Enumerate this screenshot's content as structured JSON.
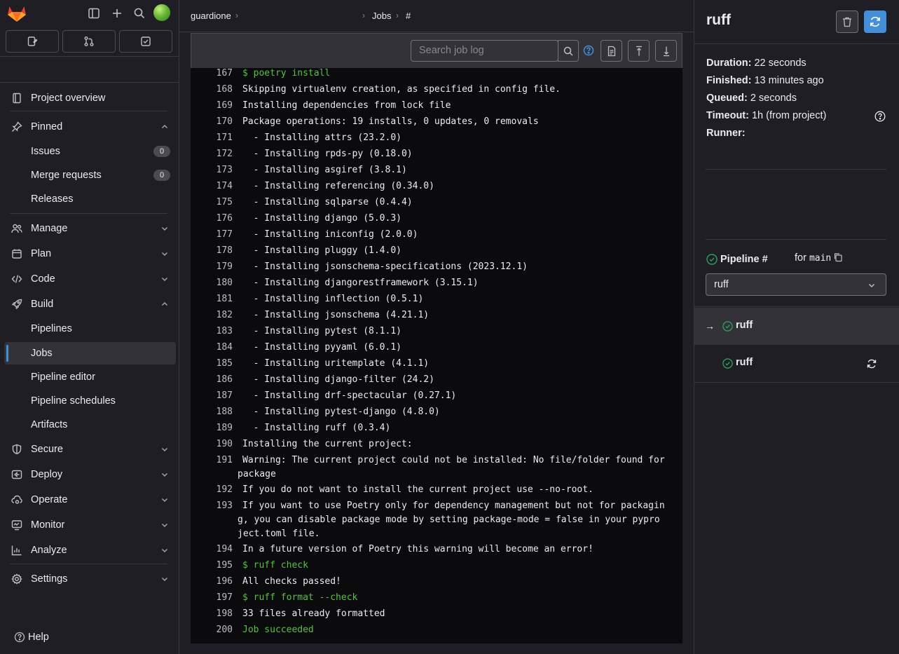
{
  "breadcrumb": {
    "project": "guardione",
    "jobs": "Jobs",
    "job_ref": "#"
  },
  "sidebar": {
    "items": [
      {
        "label": "Project overview"
      },
      {
        "label": "Pinned"
      },
      {
        "label": "Issues",
        "count": "0"
      },
      {
        "label": "Merge requests",
        "count": "0"
      },
      {
        "label": "Releases"
      },
      {
        "label": "Manage"
      },
      {
        "label": "Plan"
      },
      {
        "label": "Code"
      },
      {
        "label": "Build"
      },
      {
        "label": "Pipelines"
      },
      {
        "label": "Jobs"
      },
      {
        "label": "Pipeline editor"
      },
      {
        "label": "Pipeline schedules"
      },
      {
        "label": "Artifacts"
      },
      {
        "label": "Secure"
      },
      {
        "label": "Deploy"
      },
      {
        "label": "Operate"
      },
      {
        "label": "Monitor"
      },
      {
        "label": "Analyze"
      },
      {
        "label": "Settings"
      }
    ],
    "help_label": "Help"
  },
  "log_toolbar": {
    "search_placeholder": "Search job log"
  },
  "log": {
    "lines": [
      {
        "n": "167",
        "text": "$ poetry install"
      },
      {
        "n": "168",
        "text": "Skipping virtualenv creation, as specified in config file."
      },
      {
        "n": "169",
        "text": "Installing dependencies from lock file"
      },
      {
        "n": "170",
        "text": "Package operations: 19 installs, 0 updates, 0 removals"
      },
      {
        "n": "171",
        "text": "  - Installing attrs (23.2.0)"
      },
      {
        "n": "172",
        "text": "  - Installing rpds-py (0.18.0)"
      },
      {
        "n": "173",
        "text": "  - Installing asgiref (3.8.1)"
      },
      {
        "n": "174",
        "text": "  - Installing referencing (0.34.0)"
      },
      {
        "n": "175",
        "text": "  - Installing sqlparse (0.4.4)"
      },
      {
        "n": "176",
        "text": "  - Installing django (5.0.3)"
      },
      {
        "n": "177",
        "text": "  - Installing iniconfig (2.0.0)"
      },
      {
        "n": "178",
        "text": "  - Installing pluggy (1.4.0)"
      },
      {
        "n": "179",
        "text": "  - Installing jsonschema-specifications (2023.12.1)"
      },
      {
        "n": "180",
        "text": "  - Installing djangorestframework (3.15.1)"
      },
      {
        "n": "181",
        "text": "  - Installing inflection (0.5.1)"
      },
      {
        "n": "182",
        "text": "  - Installing jsonschema (4.21.1)"
      },
      {
        "n": "183",
        "text": "  - Installing pytest (8.1.1)"
      },
      {
        "n": "184",
        "text": "  - Installing pyyaml (6.0.1)"
      },
      {
        "n": "185",
        "text": "  - Installing uritemplate (4.1.1)"
      },
      {
        "n": "186",
        "text": "  - Installing django-filter (24.2)"
      },
      {
        "n": "187",
        "text": "  - Installing drf-spectacular (0.27.1)"
      },
      {
        "n": "188",
        "text": "  - Installing pytest-django (4.8.0)"
      },
      {
        "n": "189",
        "text": "  - Installing ruff (0.3.4)"
      },
      {
        "n": "190",
        "text": "Installing the current project:"
      },
      {
        "n": "191",
        "text": "Warning: The current project could not be installed: No file/folder found for package"
      },
      {
        "n": "192",
        "text": "If you do not want to install the current project use --no-root."
      },
      {
        "n": "193",
        "text": "If you want to use Poetry only for dependency management but not for packaging, you can disable package mode by setting package-mode = false in your pyproject.toml file."
      },
      {
        "n": "194",
        "text": "In a future version of Poetry this warning will become an error!"
      },
      {
        "n": "195",
        "text": "$ ruff check"
      },
      {
        "n": "196",
        "text": "All checks passed!"
      },
      {
        "n": "197",
        "text": "$ ruff format --check"
      },
      {
        "n": "198",
        "text": "33 files already formatted"
      },
      {
        "n": "200",
        "text": "Job succeeded"
      }
    ]
  },
  "job": {
    "title": "ruff",
    "duration_label": "Duration:",
    "duration": "22 seconds",
    "finished_label": "Finished:",
    "finished": "13 minutes ago",
    "queued_label": "Queued:",
    "queued": "2 seconds",
    "timeout_label": "Timeout:",
    "timeout": "1h (from project)",
    "runner_label": "Runner:"
  },
  "pipeline": {
    "label": "Pipeline #",
    "for": "for",
    "branch": "main",
    "stage": "ruff"
  },
  "jobs_list": [
    {
      "name": "ruff",
      "current": true
    },
    {
      "name": "ruff",
      "current": false
    }
  ],
  "colors": {
    "accent": "#428fdc",
    "success": "#2da160",
    "log_green": "#52c43b"
  }
}
